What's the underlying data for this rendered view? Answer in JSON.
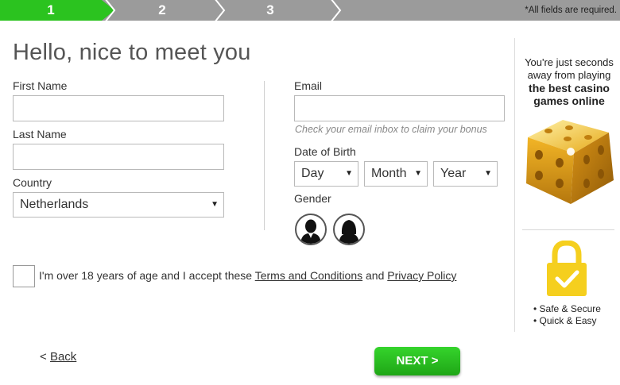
{
  "progress": {
    "steps": [
      "1",
      "2",
      "3"
    ],
    "active_step": 1,
    "required_note": "*All fields are required."
  },
  "title": "Hello, nice to meet you",
  "form": {
    "first_name": {
      "label": "First Name",
      "value": ""
    },
    "last_name": {
      "label": "Last Name",
      "value": ""
    },
    "country": {
      "label": "Country",
      "value": "Netherlands"
    },
    "email": {
      "label": "Email",
      "value": "",
      "hint": "Check your email inbox to claim your bonus"
    },
    "dob": {
      "label": "Date of Birth",
      "day": "Day",
      "month": "Month",
      "year": "Year"
    },
    "gender": {
      "label": "Gender"
    }
  },
  "terms": {
    "prefix": "I'm over 18 years of age and I accept these",
    "terms_link": "Terms and Conditions",
    "and": "and",
    "privacy_link": "Privacy Policy",
    "checked": false
  },
  "nav": {
    "back_prefix": "<",
    "back_label": "Back",
    "next_label": "NEXT >"
  },
  "promo": {
    "line1": "You're just seconds away from playing",
    "line2": "the best casino games online",
    "bullets": [
      "• Safe & Secure",
      "• Quick & Easy"
    ]
  },
  "colors": {
    "accent_green": "#2bc31f",
    "progress_gray": "#9b9b9b",
    "dice_gold": "#e0a21c",
    "lock_yellow": "#f5cf1e"
  },
  "icons": {
    "male": "male-silhouette-icon",
    "female": "female-silhouette-icon",
    "dice": "gold-dice-icon",
    "lock": "padlock-check-icon"
  }
}
